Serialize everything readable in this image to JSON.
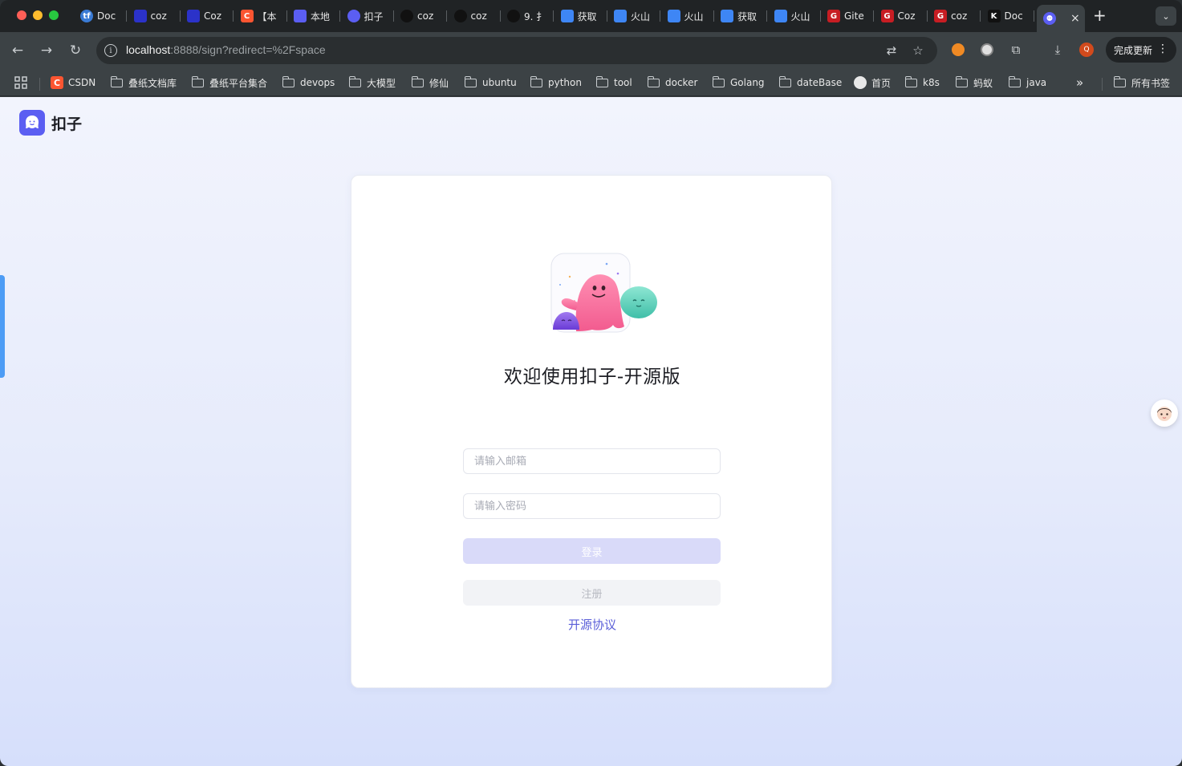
{
  "browser": {
    "tabs": [
      {
        "label": "Doc",
        "favicon": "tf-doc-icon",
        "favicon_text": "tf",
        "color": "#3a7bd5"
      },
      {
        "label": "coz",
        "favicon": "baidu-paw-icon",
        "favicon_text": "",
        "color": "#2b32c9"
      },
      {
        "label": "Coz",
        "favicon": "baidu-paw-icon",
        "favicon_text": "",
        "color": "#2b32c9"
      },
      {
        "label": "【本",
        "favicon": "csdn-icon",
        "favicon_text": "C",
        "color": "#fc5531"
      },
      {
        "label": "本地",
        "favicon": "cloud-wave-icon",
        "favicon_text": "",
        "color": "#5b5ef2"
      },
      {
        "label": "扣子",
        "favicon": "coze-icon",
        "favicon_text": "",
        "color": "#5b5ef2"
      },
      {
        "label": "coz",
        "favicon": "github-icon",
        "favicon_text": "",
        "color": "#111111"
      },
      {
        "label": "coz",
        "favicon": "github-icon",
        "favicon_text": "",
        "color": "#111111"
      },
      {
        "label": "9. 扌",
        "favicon": "github-icon",
        "favicon_text": "",
        "color": "#111111"
      },
      {
        "label": "获取",
        "favicon": "volcano-icon",
        "favicon_text": "",
        "color": "#3e86f5"
      },
      {
        "label": "火山",
        "favicon": "volcano-icon",
        "favicon_text": "",
        "color": "#3e86f5"
      },
      {
        "label": "火山",
        "favicon": "volcano-icon",
        "favicon_text": "",
        "color": "#3e86f5"
      },
      {
        "label": "获取",
        "favicon": "volcano-icon",
        "favicon_text": "",
        "color": "#3e86f5"
      },
      {
        "label": "火山",
        "favicon": "volcano-icon",
        "favicon_text": "",
        "color": "#3e86f5"
      },
      {
        "label": "Gite",
        "favicon": "gitee-icon",
        "favicon_text": "G",
        "color": "#c71d23"
      },
      {
        "label": "Coz",
        "favicon": "gitee-icon",
        "favicon_text": "G",
        "color": "#c71d23"
      },
      {
        "label": "coz",
        "favicon": "gitee-icon",
        "favicon_text": "G",
        "color": "#c71d23"
      },
      {
        "label": "Doc",
        "favicon": "k-doc-icon",
        "favicon_text": "K",
        "color": "#111111"
      }
    ],
    "active_tab": {
      "favicon": "coze-icon",
      "close": "×"
    },
    "new_tab": "+",
    "tab_search": "⌄",
    "url_host": "localhost",
    "url_rest": ":8888/sign?redirect=%2Fspace",
    "update_button": "完成更新",
    "bookmarks": [
      {
        "label": "CSDN",
        "type": "site",
        "favicon_text": "C",
        "color": "#fc5531"
      },
      {
        "label": "叠纸文档库",
        "type": "folder"
      },
      {
        "label": "叠纸平台集合",
        "type": "folder"
      },
      {
        "label": "devops",
        "type": "folder"
      },
      {
        "label": "大模型",
        "type": "folder"
      },
      {
        "label": "修仙",
        "type": "folder"
      },
      {
        "label": "ubuntu",
        "type": "folder"
      },
      {
        "label": "python",
        "type": "folder"
      },
      {
        "label": "tool",
        "type": "folder"
      },
      {
        "label": "docker",
        "type": "folder"
      },
      {
        "label": "Golang",
        "type": "folder"
      },
      {
        "label": "dateBase",
        "type": "folder"
      },
      {
        "label": "首页",
        "type": "site",
        "favicon_text": "",
        "color": "#e8e8e8"
      },
      {
        "label": "k8s",
        "type": "folder"
      },
      {
        "label": "蚂蚁",
        "type": "folder"
      },
      {
        "label": "java",
        "type": "folder"
      }
    ],
    "bookmarks_overflow": "»",
    "all_bookmarks": "所有书签"
  },
  "page": {
    "brand_name": "扣子",
    "welcome_title": "欢迎使用扣子-开源版",
    "email_placeholder": "请输入邮箱",
    "password_placeholder": "请输入密码",
    "login_button": "登录",
    "register_button": "注册",
    "license_link": "开源协议",
    "accent_color": "#5b5ef2"
  }
}
